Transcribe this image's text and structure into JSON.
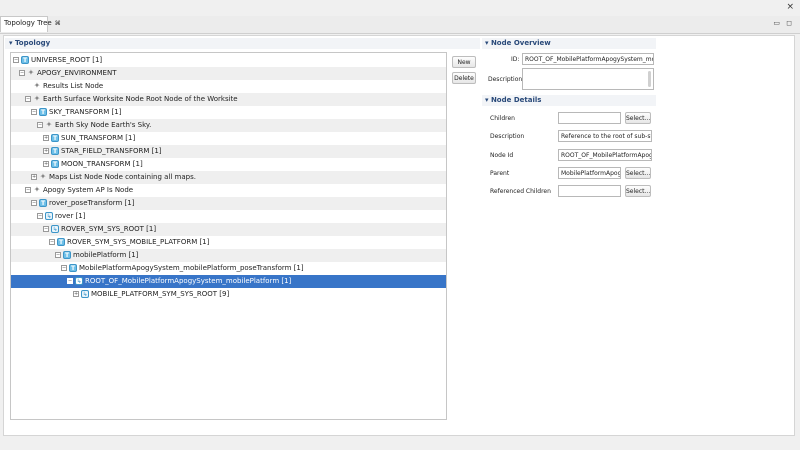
{
  "window": {
    "close_glyph": "×"
  },
  "tab": {
    "title": "Topology Tree",
    "close_glyph": "⌘"
  },
  "window_controls": {
    "minimize": "▭",
    "maximize": "◻"
  },
  "topology": {
    "header": "Topology"
  },
  "tree": {
    "rows": [
      {
        "label": "UNIVERSE_ROOT [1]",
        "icon": "T",
        "level": 0,
        "expander": "−",
        "alt": false,
        "selected": false
      },
      {
        "label": "APOGY_ENVIRONMENT",
        "icon": "N",
        "level": 1,
        "expander": "−",
        "alt": true,
        "selected": false
      },
      {
        "label": "Results List Node",
        "icon": "N",
        "level": 2,
        "expander": "",
        "alt": false,
        "selected": false
      },
      {
        "label": "Earth Surface Worksite Node Root Node of the Worksite",
        "icon": "N",
        "level": 2,
        "expander": "−",
        "alt": true,
        "selected": false
      },
      {
        "label": "SKY_TRANSFORM [1]",
        "icon": "T",
        "level": 3,
        "expander": "−",
        "alt": false,
        "selected": false
      },
      {
        "label": "Earth Sky Node Earth's Sky.",
        "icon": "N",
        "level": 4,
        "expander": "−",
        "alt": true,
        "selected": false
      },
      {
        "label": "SUN_TRANSFORM [1]",
        "icon": "T",
        "level": 5,
        "expander": "+",
        "alt": false,
        "selected": false
      },
      {
        "label": "STAR_FIELD_TRANSFORM [1]",
        "icon": "T",
        "level": 5,
        "expander": "+",
        "alt": true,
        "selected": false
      },
      {
        "label": "MOON_TRANSFORM [1]",
        "icon": "T",
        "level": 5,
        "expander": "+",
        "alt": false,
        "selected": false
      },
      {
        "label": "Maps List Node Node containing all maps.",
        "icon": "N",
        "level": 3,
        "expander": "+",
        "alt": true,
        "selected": false
      },
      {
        "label": "Apogy System AP Is Node",
        "icon": "N",
        "level": 2,
        "expander": "−",
        "alt": false,
        "selected": false
      },
      {
        "label": "rover_poseTransform [1]",
        "icon": "T",
        "level": 3,
        "expander": "−",
        "alt": true,
        "selected": false
      },
      {
        "label": "rover [1]",
        "icon": "R",
        "level": 4,
        "expander": "−",
        "alt": false,
        "selected": false
      },
      {
        "label": "ROVER_SYM_SYS_ROOT [1]",
        "icon": "R",
        "level": 5,
        "expander": "−",
        "alt": true,
        "selected": false
      },
      {
        "label": "ROVER_SYM_SYS_MOBILE_PLATFORM [1]",
        "icon": "T",
        "level": 6,
        "expander": "−",
        "alt": false,
        "selected": false
      },
      {
        "label": "mobilePlatform [1]",
        "icon": "T",
        "level": 7,
        "expander": "−",
        "alt": true,
        "selected": false
      },
      {
        "label": "MobilePlatformApogySystem_mobilePlatform_poseTransform [1]",
        "icon": "T",
        "level": 8,
        "expander": "−",
        "alt": false,
        "selected": false
      },
      {
        "label": "ROOT_OF_MobilePlatformApogySystem_mobilePlatform [1]",
        "icon": "R",
        "level": 9,
        "expander": "−",
        "alt": false,
        "selected": true
      },
      {
        "label": "MOBILE_PLATFORM_SYM_SYS_ROOT [9]",
        "icon": "R",
        "level": 10,
        "expander": "+",
        "alt": false,
        "selected": false
      }
    ]
  },
  "buttons": {
    "new": "New",
    "delete": "Delete"
  },
  "overview": {
    "header": "Node Overview",
    "id_label": "ID:",
    "id_value": "ROOT_OF_MobilePlatformApogySystem_mobil",
    "description_label": "Description:",
    "description_value": ""
  },
  "details": {
    "header": "Node Details",
    "children_label": "Children",
    "children_value": "",
    "description_label": "Description",
    "description_value": "Reference to the root of sub-syst",
    "nodeid_label": "Node Id",
    "nodeid_value": "ROOT_OF_MobilePlatformApogyS",
    "parent_label": "Parent",
    "parent_value": "MobilePlatformApogyS",
    "refchildren_label": "Referenced Children",
    "refchildren_value": "",
    "select_label": "Select..."
  },
  "colors": {
    "selection": "#3875c8",
    "accent": "#2a4a7a"
  }
}
